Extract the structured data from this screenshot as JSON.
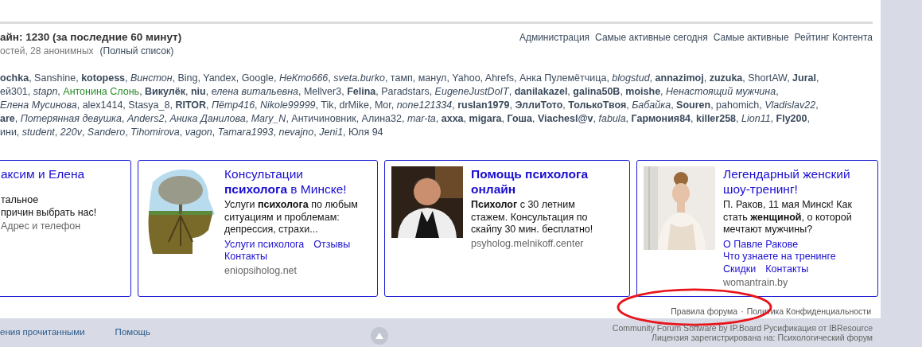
{
  "online": {
    "title": "айн: 1230 (за последние 60 минут)",
    "summary": "остей, 28 анонимных",
    "full_list_link": "(Полный список)",
    "links": [
      "Администрация",
      "Самые активные сегодня",
      "Самые активные",
      "Рейтинг Контента"
    ],
    "name_lines": [
      [
        {
          "text": "**ochka**, Sanshine, **kotopess**, *Винстон*, Bing, Yandex, Google, *НеКто666*, *sveta.burko*, тамп, манул, Yahoo, Ahrefs, Анка Пулемётчица, *blogstud*, **annazimoj**, **zuzuka**, ShortAW, **Jural**,",
          "color": "#3b4a5c"
        }
      ],
      [
        {
          "text": "ей301, *stapn*, ",
          "color": "#3b4a5c"
        },
        {
          "text": "Антонина Слонь",
          "color": "#2b8a2b"
        },
        {
          "text": ", **Викулёк**, **niu**, *елена витальевна*, Mellver3, **Felina**, Paradstars, *EugeneJustDoIT*, **danilakazel**, **galina50B**, **moishe**, *Ненастоящий мужчина*,",
          "color": "#3b4a5c"
        }
      ],
      [
        {
          "text": "*Елена Мусинова*, alex1414, Stasya_8, **RITOR**, *Пётр416*, *Nikole99999*, Tik, drMike, Mor, *none121334*, **ruslan1979**, **ЭллиТото**, **ТолькоТвоя**, *Бабайка*, **Souren**, pahomich, *Vladislav22*,",
          "color": "#3b4a5c"
        }
      ],
      [
        {
          "text": "**are**, *Потерянная девушка*, *Anders2*, *Аника Данилова*, *Mary_N*, Античиновник, Алина32, *mar-ta*, **axxa**, **migara**, **Гоша**, **Viachesl@v**, *fabula*, **Гармония84**, **killer258**, *Lion11*, **Fly200**,",
          "color": "#3b4a5c"
        }
      ],
      [
        {
          "text": "ини, *student*, *220v*, *Sandero*, *Tihomirova*, *vagon*, *Tamara1993*, *nevajno*, *Jeni1*, Юля 94",
          "color": "#3b4a5c"
        }
      ]
    ]
  },
  "ads": [
    {
      "title": "аксим и Елена",
      "title_bold": false,
      "body": "тальное\nпричин выбрать нас!",
      "domain": "Адрес и телефон"
    },
    {
      "image": {
        "kind": "picture"
      },
      "title": "Консультации\n**психолога** в Минске!",
      "title_bold": false,
      "body": "Услуги **психолога** по любым\nситуациям и проблемам:\nдепрессия, страхи...",
      "links": [
        "Услуги психолога",
        "Отзывы",
        "Контакты"
      ],
      "domain": "eniopsiholog.net"
    },
    {
      "image": {
        "kind": "picture"
      },
      "title": "Помощь психолога\nонлайн",
      "title_bold": true,
      "body": "**Психолог** с 30 летним\nстажем. Консультация по\nскайпу 30 мин. бесплатно!",
      "domain": "psyholog.melnikoff.center"
    },
    {
      "image": {
        "kind": "picture"
      },
      "title": "Легендарный женский\nшоу-тренинг!",
      "title_bold": false,
      "body": "П. Раков, 11 мая Минск! Как\nстать **женщиной**, о которой\nмечтают мужчины?",
      "links": [
        "О Павле Ракове",
        "Что узнаете на тренинге",
        "Скидки",
        "Контакты"
      ],
      "domain": "womantrain.by"
    }
  ],
  "panel_footer": {
    "links": [
      "Правила форума",
      "Политика Конфиденциальности"
    ],
    "separator": "·"
  },
  "footer": {
    "links": [
      "ения прочитанными",
      "Помощь"
    ],
    "credits": [
      "Community Forum Software by IP.Board Русификация от IBResource",
      "Лицензия зарегистрирована на: Психологический форум"
    ]
  }
}
